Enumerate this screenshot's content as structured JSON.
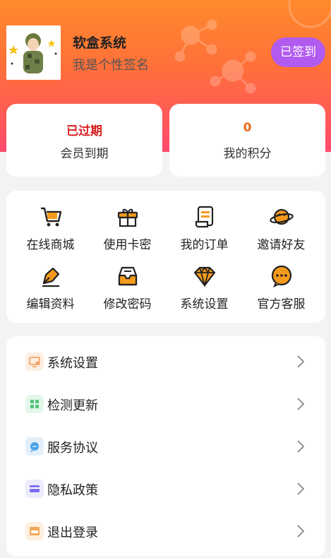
{
  "profile": {
    "app_name": "软盒系统",
    "signature": "我是个性签名",
    "checkin_label": "已签到"
  },
  "stats": [
    {
      "value": "已过期",
      "label": "会员到期",
      "value_color": "#d81e1e"
    },
    {
      "value": "0",
      "label": "我的积分",
      "value_color": "#e86a16"
    }
  ],
  "quick_menu": [
    {
      "label": "在线商城",
      "icon": "shopping-cart-icon"
    },
    {
      "label": "使用卡密",
      "icon": "gift-icon"
    },
    {
      "label": "我的订单",
      "icon": "order-scroll-icon"
    },
    {
      "label": "邀请好友",
      "icon": "planet-icon"
    },
    {
      "label": "编辑资料",
      "icon": "pen-nib-icon"
    },
    {
      "label": "修改密码",
      "icon": "inbox-icon"
    },
    {
      "label": "系统设置",
      "icon": "diamond-icon"
    },
    {
      "label": "官方客服",
      "icon": "chat-bubble-icon"
    }
  ],
  "settings_list": [
    {
      "label": "系统设置",
      "icon": "monitor-settings-icon",
      "color": "#f4a46a"
    },
    {
      "label": "检测更新",
      "icon": "grid-apps-icon",
      "color": "#55c47a"
    },
    {
      "label": "服务协议",
      "icon": "message-icon",
      "color": "#4aa3e8"
    },
    {
      "label": "隐私政策",
      "icon": "card-icon",
      "color": "#7b6ef0"
    },
    {
      "label": "退出登录",
      "icon": "logout-box-icon",
      "color": "#f0a85a"
    }
  ],
  "colors": {
    "accent_orange": "#f39a1d",
    "checkin_purple": "#b25bf0"
  }
}
